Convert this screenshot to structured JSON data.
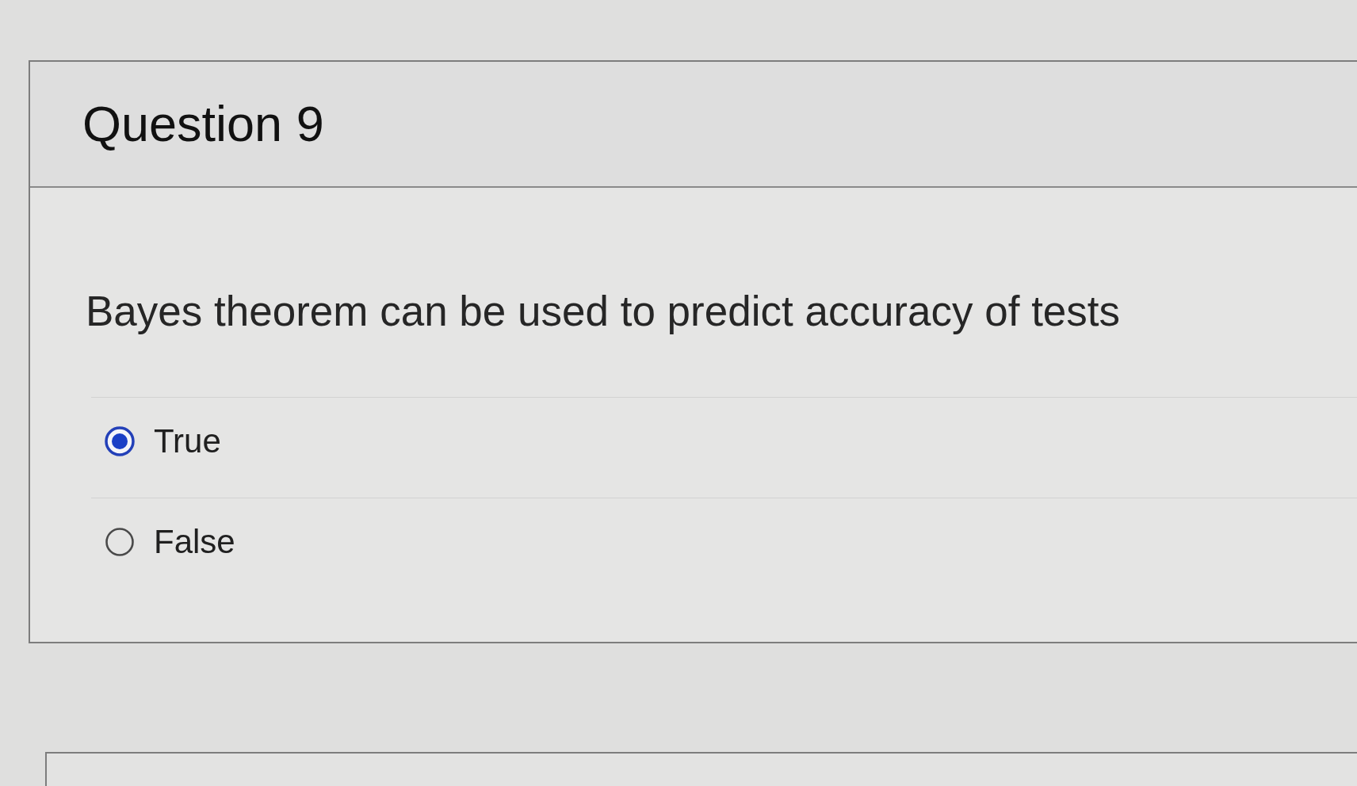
{
  "question": {
    "title": "Question 9",
    "text": "Bayes theorem can be used to predict accuracy of tests",
    "answers": [
      {
        "label": "True",
        "selected": true
      },
      {
        "label": "False",
        "selected": false
      }
    ]
  }
}
